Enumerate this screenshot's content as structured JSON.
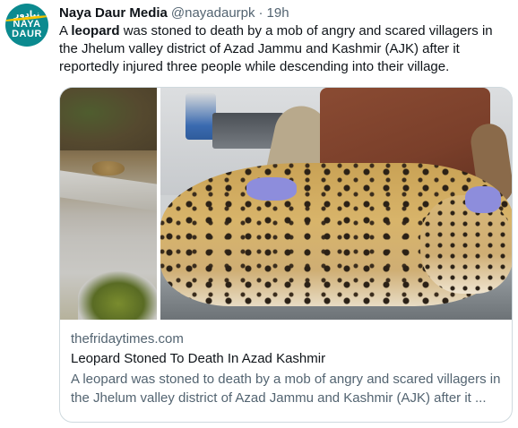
{
  "author": {
    "avatar_text_top": "نیادور",
    "avatar_text_line1": "NAYA",
    "avatar_text_line2": "DAUR",
    "name": "Naya Daur Media",
    "handle": "@nayadaurpk",
    "separator": "·",
    "time": "19h"
  },
  "tweet": {
    "text_before": "A ",
    "text_bold": "leopard",
    "text_after": " was stoned to death by a mob of angry and scared villagers in the Jhelum valley district of Azad Jammu and Kashmir (AJK) after it reportedly injured three people while descending into their village."
  },
  "card": {
    "domain": "thefridaytimes.com",
    "title": "Leopard Stoned To Death In Azad Kashmir",
    "description": "A leopard was stoned to death by a mob of angry and scared villagers in the Jhelum valley district of Azad Jammu and Kashmir (AJK) after it ..."
  },
  "colors": {
    "text_primary": "#0f1419",
    "text_secondary": "#536471",
    "border": "#cfd9de",
    "avatar_bg": "#0b8a8f",
    "avatar_accent": "#f5c400"
  }
}
